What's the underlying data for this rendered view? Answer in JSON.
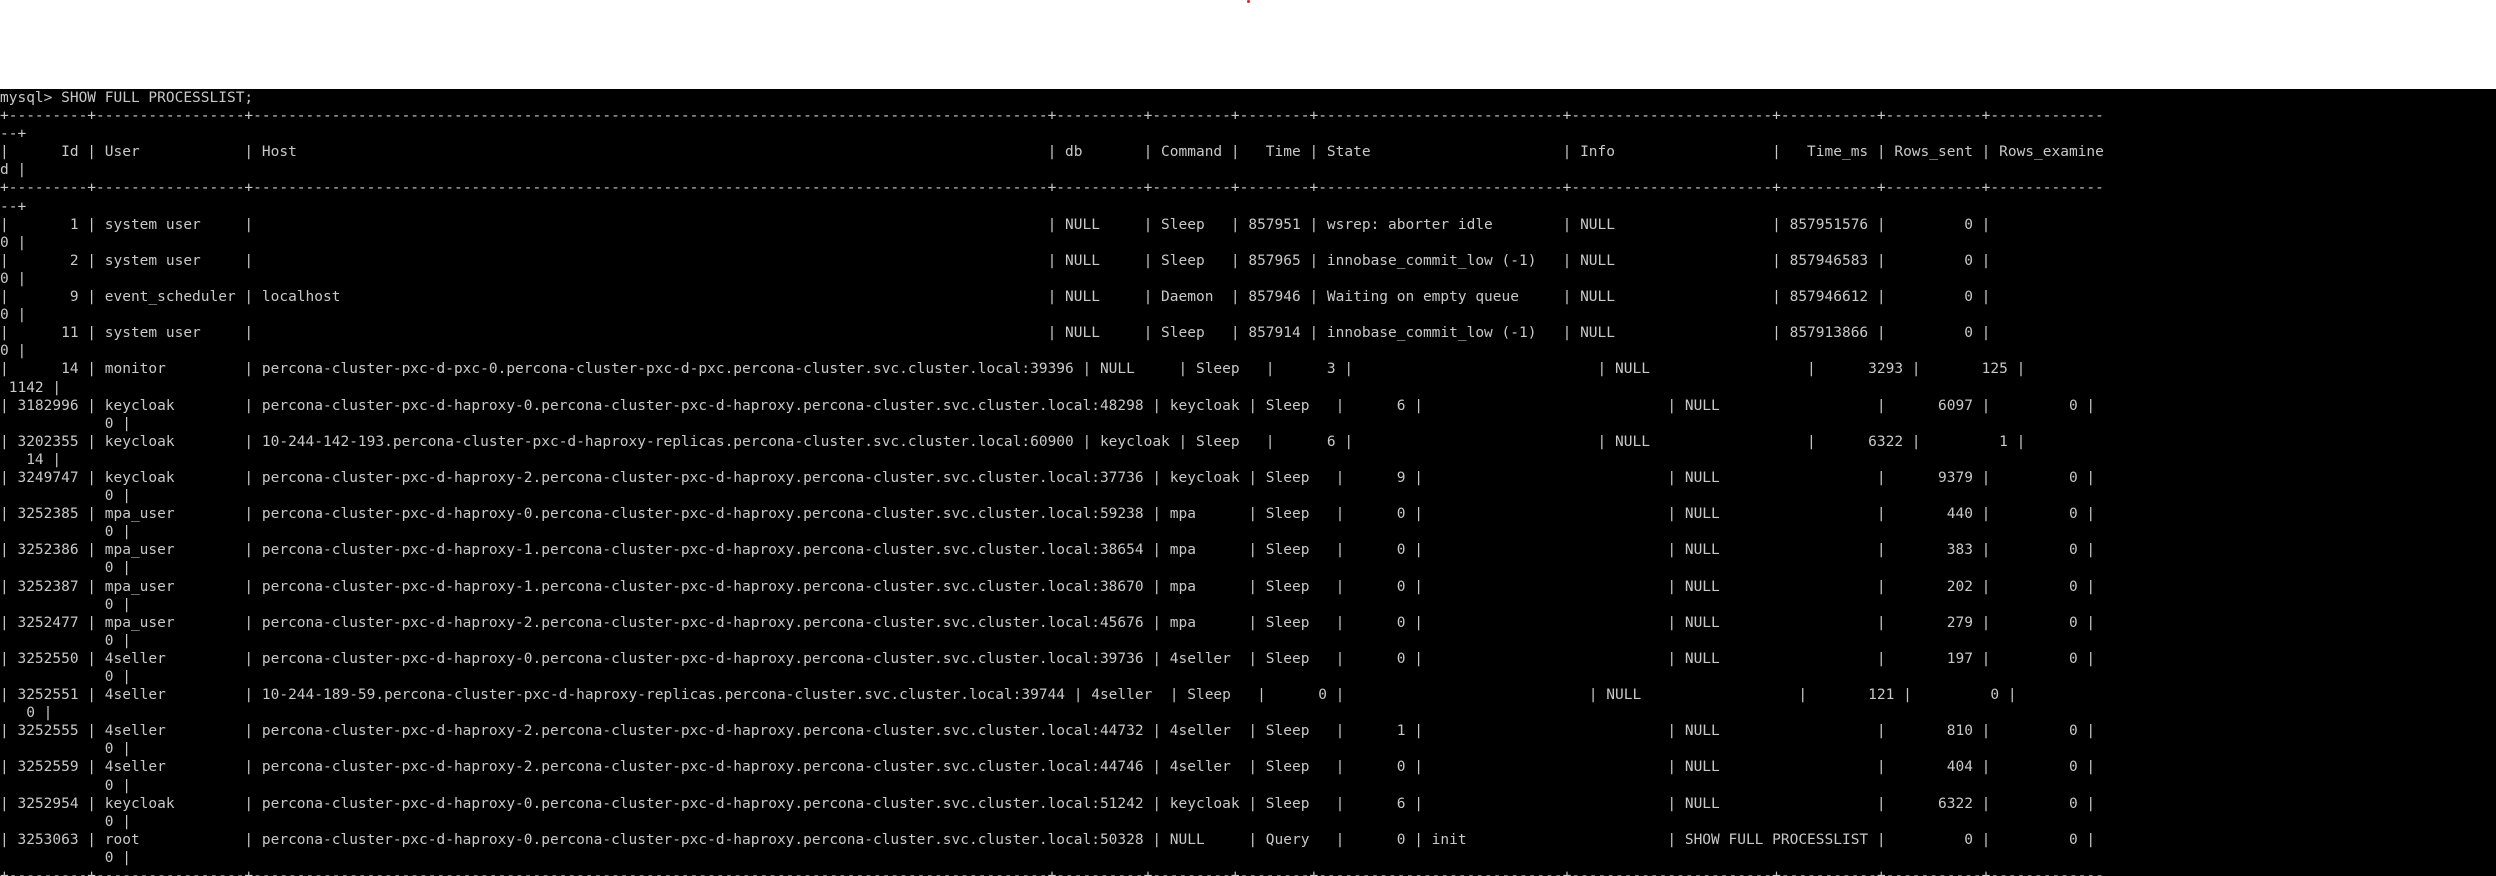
{
  "colors": {
    "terminal_bg": "#000000",
    "terminal_fg": "#c8c8c8",
    "page_bg": "#ffffff",
    "cursor_dot": "#e02020"
  },
  "prompt": "mysql> ",
  "command": "SHOW FULL PROCESSLIST;",
  "columns": [
    {
      "key": "Id",
      "label": "Id",
      "width": 7,
      "align": "right"
    },
    {
      "key": "User",
      "label": "User",
      "width": 15,
      "align": "left"
    },
    {
      "key": "Host",
      "label": "Host",
      "width": 89,
      "align": "left"
    },
    {
      "key": "db",
      "label": "db",
      "width": 8,
      "align": "left"
    },
    {
      "key": "Command",
      "label": "Command",
      "width": 7,
      "align": "left"
    },
    {
      "key": "Time",
      "label": "Time",
      "width": 6,
      "align": "right"
    },
    {
      "key": "State",
      "label": "State",
      "width": 26,
      "align": "left"
    },
    {
      "key": "Info",
      "label": "Info",
      "width": 21,
      "align": "left"
    },
    {
      "key": "Time_ms",
      "label": "Time_ms",
      "width": 9,
      "align": "right"
    },
    {
      "key": "Rows_sent",
      "label": "Rows_sent",
      "width": 9,
      "align": "right"
    },
    {
      "key": "Rows_examined",
      "label": "Rows_examined",
      "width": 13,
      "align": "right"
    }
  ],
  "rows": [
    {
      "Id": "1",
      "User": "system user",
      "Host": "",
      "db": "NULL",
      "Command": "Sleep",
      "Time": "857951",
      "State": "wsrep: aborter idle",
      "Info": "NULL",
      "Time_ms": "857951576",
      "Rows_sent": "0",
      "Rows_examined": "0"
    },
    {
      "Id": "2",
      "User": "system user",
      "Host": "",
      "db": "NULL",
      "Command": "Sleep",
      "Time": "857965",
      "State": "innobase_commit_low (-1)",
      "Info": "NULL",
      "Time_ms": "857946583",
      "Rows_sent": "0",
      "Rows_examined": "0"
    },
    {
      "Id": "9",
      "User": "event_scheduler",
      "Host": "localhost",
      "db": "NULL",
      "Command": "Daemon",
      "Time": "857946",
      "State": "Waiting on empty queue",
      "Info": "NULL",
      "Time_ms": "857946612",
      "Rows_sent": "0",
      "Rows_examined": "0"
    },
    {
      "Id": "11",
      "User": "system user",
      "Host": "",
      "db": "NULL",
      "Command": "Sleep",
      "Time": "857914",
      "State": "innobase_commit_low (-1)",
      "Info": "NULL",
      "Time_ms": "857913866",
      "Rows_sent": "0",
      "Rows_examined": "0"
    },
    {
      "Id": "14",
      "User": "monitor",
      "Host": "percona-cluster-pxc-d-pxc-0.percona-cluster-pxc-d-pxc.percona-cluster.svc.cluster.local:39396",
      "db": "NULL",
      "Command": "Sleep",
      "Time": "3",
      "State": "",
      "Info": "NULL",
      "Time_ms": "3293",
      "Rows_sent": "125",
      "Rows_examined": "1142"
    },
    {
      "Id": "3182996",
      "User": "keycloak",
      "Host": "percona-cluster-pxc-d-haproxy-0.percona-cluster-pxc-d-haproxy.percona-cluster.svc.cluster.local:48298",
      "db": "keycloak",
      "Command": "Sleep",
      "Time": "6",
      "State": "",
      "Info": "NULL",
      "Time_ms": "6097",
      "Rows_sent": "0",
      "Rows_examined": "0"
    },
    {
      "Id": "3202355",
      "User": "keycloak",
      "Host": "10-244-142-193.percona-cluster-pxc-d-haproxy-replicas.percona-cluster.svc.cluster.local:60900",
      "db": "keycloak",
      "Command": "Sleep",
      "Time": "6",
      "State": "",
      "Info": "NULL",
      "Time_ms": "6322",
      "Rows_sent": "1",
      "Rows_examined": "14"
    },
    {
      "Id": "3249747",
      "User": "keycloak",
      "Host": "percona-cluster-pxc-d-haproxy-2.percona-cluster-pxc-d-haproxy.percona-cluster.svc.cluster.local:37736",
      "db": "keycloak",
      "Command": "Sleep",
      "Time": "9",
      "State": "",
      "Info": "NULL",
      "Time_ms": "9379",
      "Rows_sent": "0",
      "Rows_examined": "0"
    },
    {
      "Id": "3252385",
      "User": "mpa_user",
      "Host": "percona-cluster-pxc-d-haproxy-0.percona-cluster-pxc-d-haproxy.percona-cluster.svc.cluster.local:59238",
      "db": "mpa",
      "Command": "Sleep",
      "Time": "0",
      "State": "",
      "Info": "NULL",
      "Time_ms": "440",
      "Rows_sent": "0",
      "Rows_examined": "0"
    },
    {
      "Id": "3252386",
      "User": "mpa_user",
      "Host": "percona-cluster-pxc-d-haproxy-1.percona-cluster-pxc-d-haproxy.percona-cluster.svc.cluster.local:38654",
      "db": "mpa",
      "Command": "Sleep",
      "Time": "0",
      "State": "",
      "Info": "NULL",
      "Time_ms": "383",
      "Rows_sent": "0",
      "Rows_examined": "0"
    },
    {
      "Id": "3252387",
      "User": "mpa_user",
      "Host": "percona-cluster-pxc-d-haproxy-1.percona-cluster-pxc-d-haproxy.percona-cluster.svc.cluster.local:38670",
      "db": "mpa",
      "Command": "Sleep",
      "Time": "0",
      "State": "",
      "Info": "NULL",
      "Time_ms": "202",
      "Rows_sent": "0",
      "Rows_examined": "0"
    },
    {
      "Id": "3252477",
      "User": "mpa_user",
      "Host": "percona-cluster-pxc-d-haproxy-2.percona-cluster-pxc-d-haproxy.percona-cluster.svc.cluster.local:45676",
      "db": "mpa",
      "Command": "Sleep",
      "Time": "0",
      "State": "",
      "Info": "NULL",
      "Time_ms": "279",
      "Rows_sent": "0",
      "Rows_examined": "0"
    },
    {
      "Id": "3252550",
      "User": "4seller",
      "Host": "percona-cluster-pxc-d-haproxy-0.percona-cluster-pxc-d-haproxy.percona-cluster.svc.cluster.local:39736",
      "db": "4seller",
      "Command": "Sleep",
      "Time": "0",
      "State": "",
      "Info": "NULL",
      "Time_ms": "197",
      "Rows_sent": "0",
      "Rows_examined": "0"
    },
    {
      "Id": "3252551",
      "User": "4seller",
      "Host": "10-244-189-59.percona-cluster-pxc-d-haproxy-replicas.percona-cluster.svc.cluster.local:39744",
      "db": "4seller",
      "Command": "Sleep",
      "Time": "0",
      "State": "",
      "Info": "NULL",
      "Time_ms": "121",
      "Rows_sent": "0",
      "Rows_examined": "0"
    },
    {
      "Id": "3252555",
      "User": "4seller",
      "Host": "percona-cluster-pxc-d-haproxy-2.percona-cluster-pxc-d-haproxy.percona-cluster.svc.cluster.local:44732",
      "db": "4seller",
      "Command": "Sleep",
      "Time": "1",
      "State": "",
      "Info": "NULL",
      "Time_ms": "810",
      "Rows_sent": "0",
      "Rows_examined": "0"
    },
    {
      "Id": "3252559",
      "User": "4seller",
      "Host": "percona-cluster-pxc-d-haproxy-2.percona-cluster-pxc-d-haproxy.percona-cluster.svc.cluster.local:44746",
      "db": "4seller",
      "Command": "Sleep",
      "Time": "0",
      "State": "",
      "Info": "NULL",
      "Time_ms": "404",
      "Rows_sent": "0",
      "Rows_examined": "0"
    },
    {
      "Id": "3252954",
      "User": "keycloak",
      "Host": "percona-cluster-pxc-d-haproxy-0.percona-cluster-pxc-d-haproxy.percona-cluster.svc.cluster.local:51242",
      "db": "keycloak",
      "Command": "Sleep",
      "Time": "6",
      "State": "",
      "Info": "NULL",
      "Time_ms": "6322",
      "Rows_sent": "0",
      "Rows_examined": "0"
    },
    {
      "Id": "3253063",
      "User": "root",
      "Host": "percona-cluster-pxc-d-haproxy-0.percona-cluster-pxc-d-haproxy.percona-cluster.svc.cluster.local:50328",
      "db": "NULL",
      "Command": "Query",
      "Time": "0",
      "State": "init",
      "Info": "SHOW FULL PROCESSLIST",
      "Time_ms": "0",
      "Rows_sent": "0",
      "Rows_examined": "0"
    }
  ]
}
